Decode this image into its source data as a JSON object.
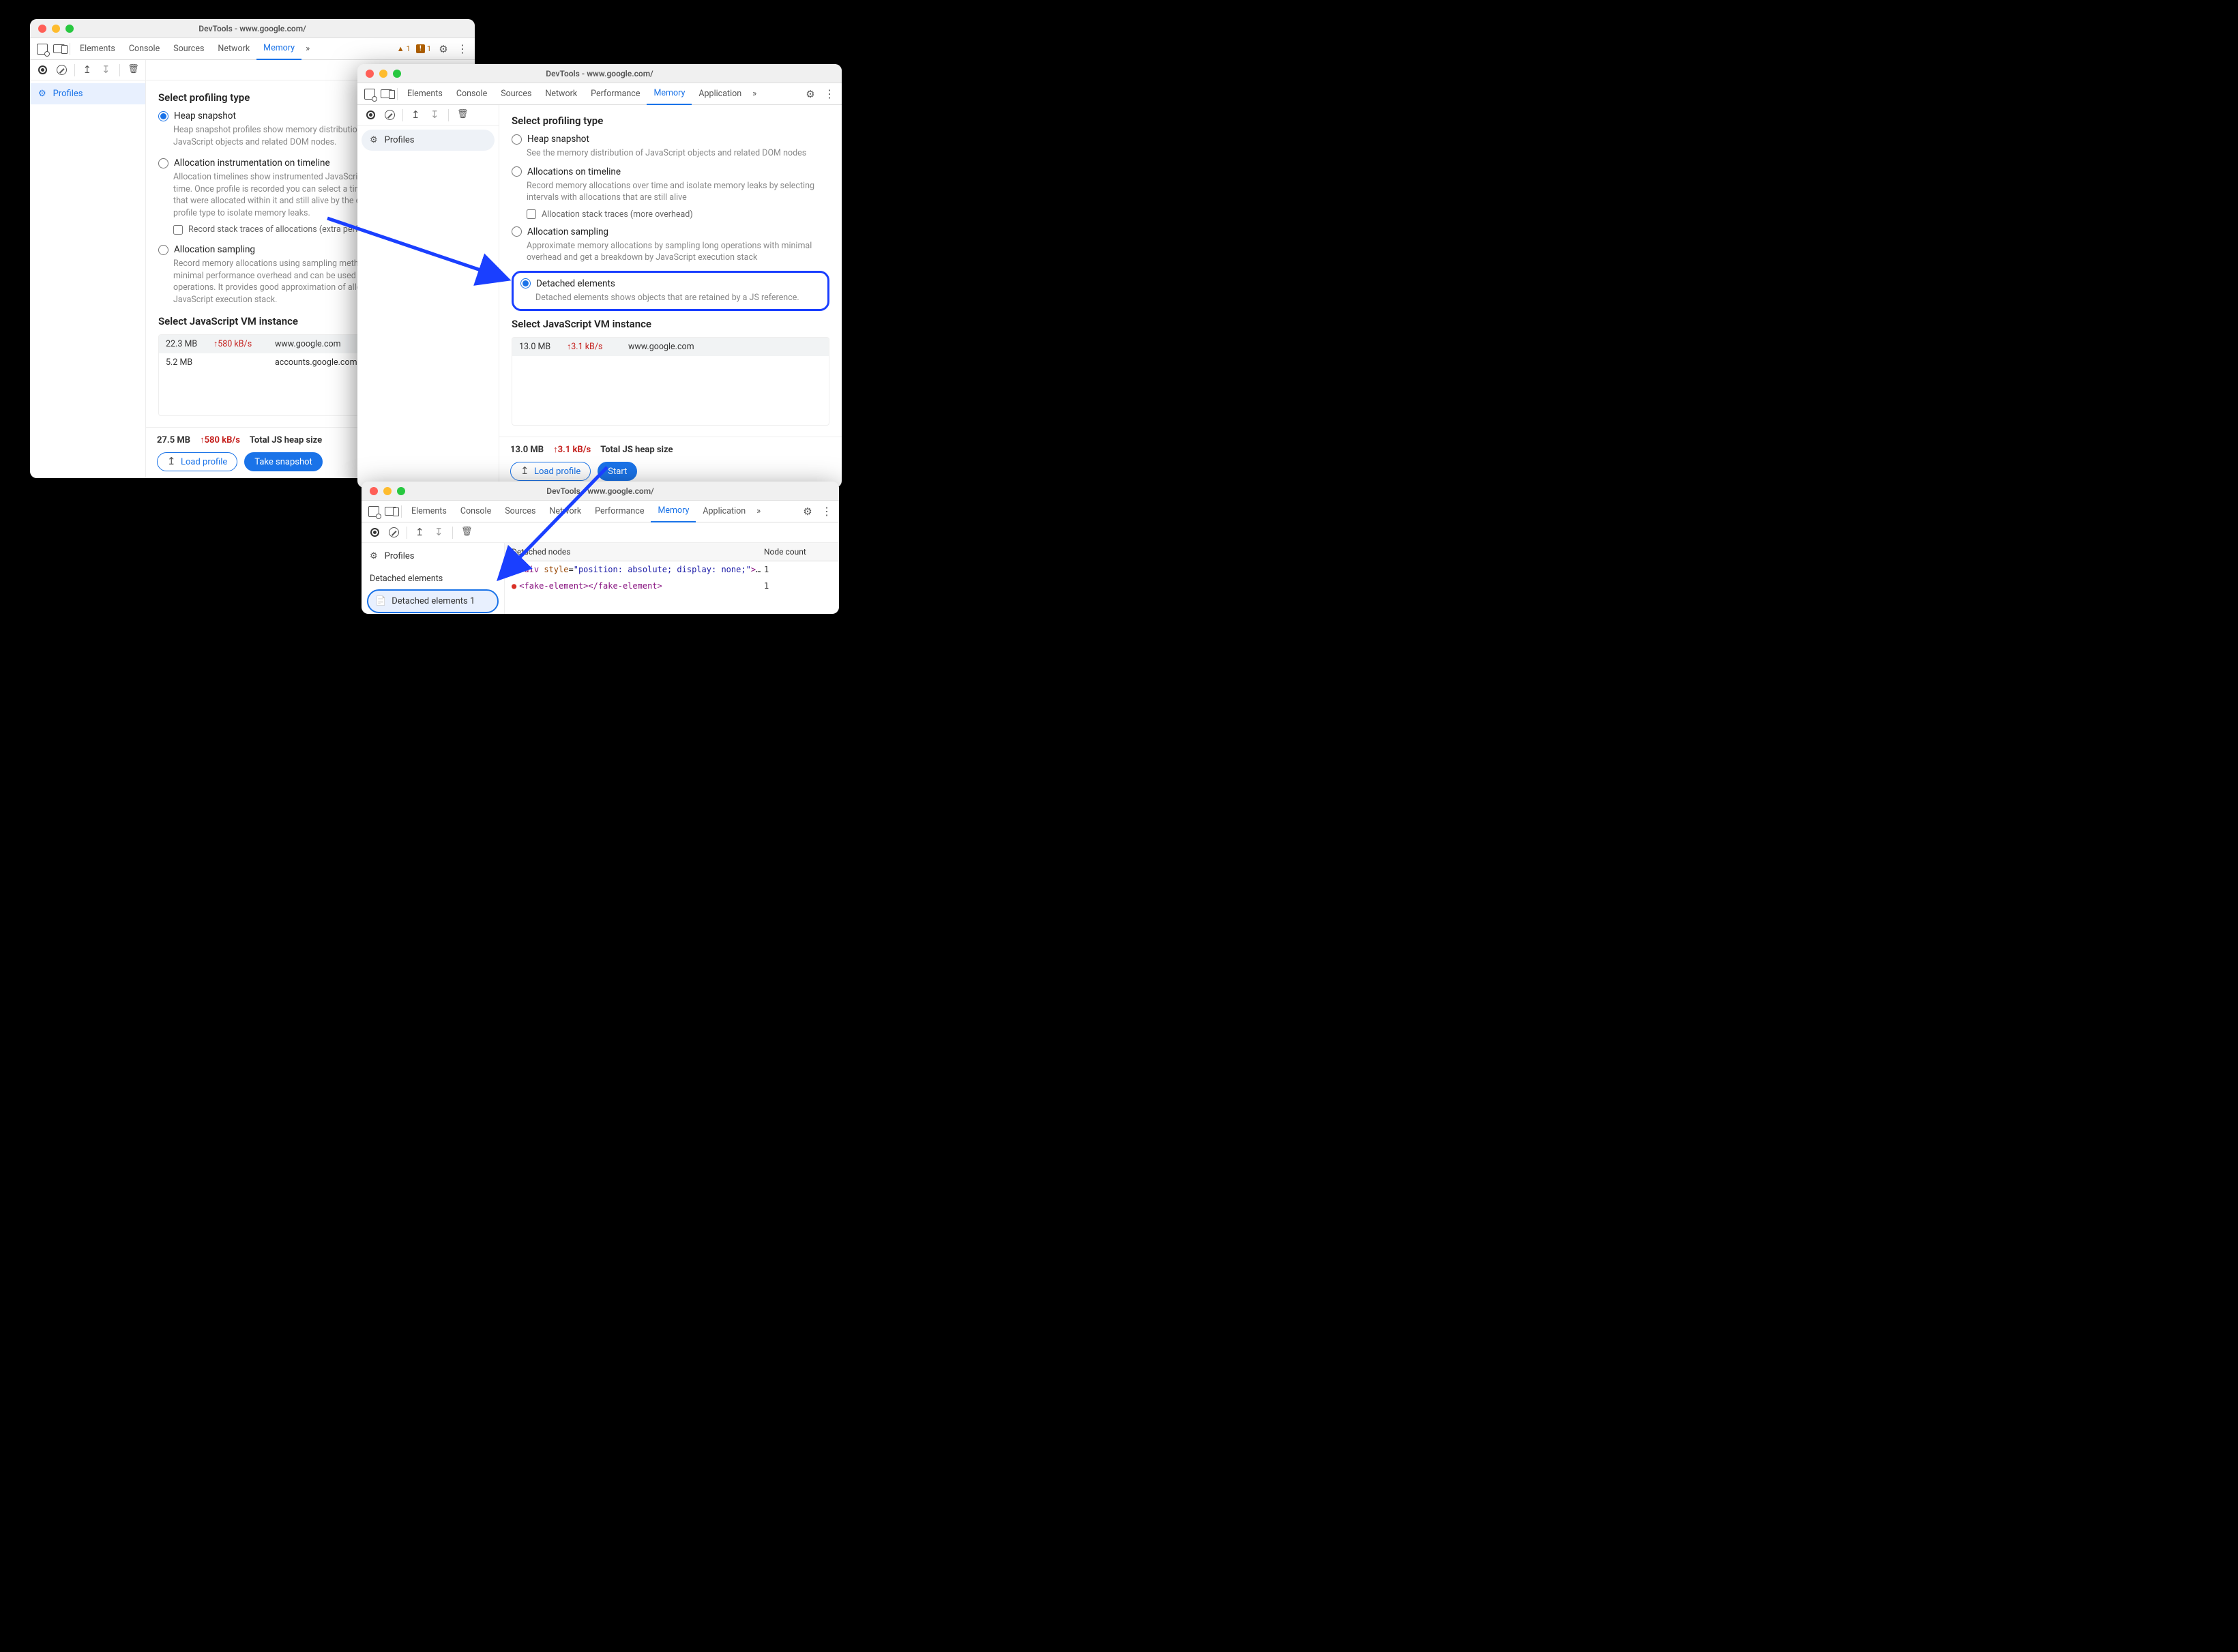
{
  "win1": {
    "title": "DevTools - www.google.com/",
    "tabs": [
      "Elements",
      "Console",
      "Sources",
      "Network",
      "Memory"
    ],
    "active_tab": "Memory",
    "warn_count": "1",
    "err_count": "1",
    "sidebar_profiles": "Profiles",
    "section_profiling": "Select profiling type",
    "opt_heap": "Heap snapshot",
    "opt_heap_desc": "Heap snapshot profiles show memory distribution among your page's JavaScript objects and related DOM nodes.",
    "opt_alloc": "Allocation instrumentation on timeline",
    "opt_alloc_desc": "Allocation timelines show instrumented JavaScript memory allocations over time. Once profile is recorded you can select a time interval to see objects that were allocated within it and still alive by the end of recording. Use this profile type to isolate memory leaks.",
    "opt_alloc_sub": "Record stack traces of allocations (extra performance overhead)",
    "opt_samp": "Allocation sampling",
    "opt_samp_desc": "Record memory allocations using sampling method. This profile type has minimal performance overhead and can be used for long running operations. It provides good approximation of allocations broken down by JavaScript execution stack.",
    "section_vm": "Select JavaScript VM instance",
    "vm": [
      {
        "size": "22.3 MB",
        "rate": "580 kB/s",
        "host": "www.google.com"
      },
      {
        "size": "5.2 MB",
        "rate": "",
        "host": "accounts.google.com: RotateCookiesPage"
      }
    ],
    "total_size": "27.5 MB",
    "total_rate": "580 kB/s",
    "total_label": "Total JS heap size",
    "btn_load": "Load profile",
    "btn_snap": "Take snapshot"
  },
  "win2": {
    "title": "DevTools - www.google.com/",
    "tabs": [
      "Elements",
      "Console",
      "Sources",
      "Network",
      "Performance",
      "Memory",
      "Application"
    ],
    "active_tab": "Memory",
    "sidebar_profiles": "Profiles",
    "section_profiling": "Select profiling type",
    "opt_heap": "Heap snapshot",
    "opt_heap_desc": "See the memory distribution of JavaScript objects and related DOM nodes",
    "opt_alloc": "Allocations on timeline",
    "opt_alloc_desc": "Record memory allocations over time and isolate memory leaks by selecting intervals with allocations that are still alive",
    "opt_alloc_sub": "Allocation stack traces (more overhead)",
    "opt_samp": "Allocation sampling",
    "opt_samp_desc": "Approximate memory allocations by sampling long operations with minimal overhead and get a breakdown by JavaScript execution stack",
    "opt_det": "Detached elements",
    "opt_det_desc": "Detached elements shows objects that are retained by a JS reference.",
    "section_vm": "Select JavaScript VM instance",
    "vm": [
      {
        "size": "13.0 MB",
        "rate": "3.1 kB/s",
        "host": "www.google.com"
      }
    ],
    "total_size": "13.0 MB",
    "total_rate": "3.1 kB/s",
    "total_label": "Total JS heap size",
    "btn_load": "Load profile",
    "btn_start": "Start"
  },
  "win3": {
    "title": "DevTools - www.google.com/",
    "tabs": [
      "Elements",
      "Console",
      "Sources",
      "Network",
      "Performance",
      "Memory",
      "Application"
    ],
    "active_tab": "Memory",
    "sidebar_profiles": "Profiles",
    "sidebar_heading": "Detached elements",
    "sidebar_selected": "Detached elements 1",
    "col_nodes": "Detached nodes",
    "col_count": "Node count",
    "rows": [
      {
        "html": "<div style=\"position: absolute; display: none;\"></div>",
        "count": "1"
      },
      {
        "html": "<fake-element></fake-element>",
        "count": "1"
      }
    ]
  }
}
